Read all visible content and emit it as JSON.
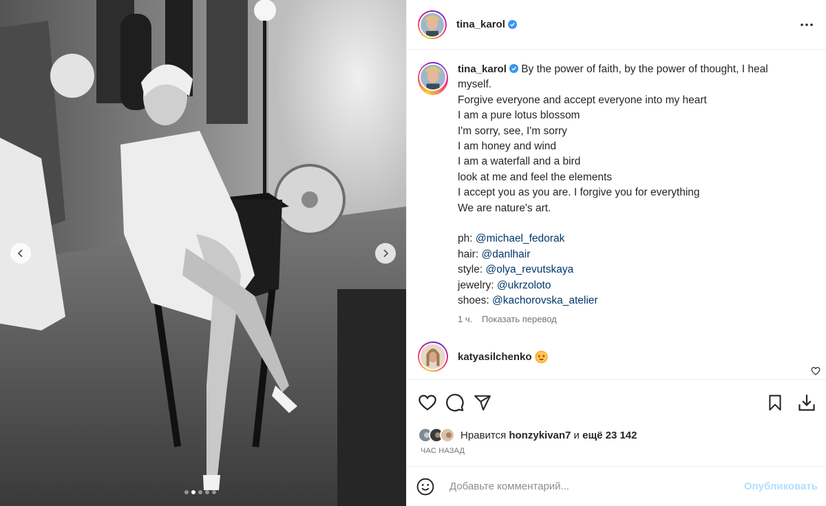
{
  "header": {
    "username": "tina_karol"
  },
  "caption": {
    "username": "tina_karol",
    "lines": [
      "By the power of faith, by the power of thought, I heal myself.",
      "Forgive everyone and accept everyone into my heart",
      "I am a pure lotus blossom",
      "I'm sorry, see, I'm sorry",
      "I am honey and wind",
      "I am a waterfall and a bird",
      "look at me and feel the elements",
      "I accept you as you are. I forgive you for everything",
      "We are nature's art."
    ],
    "credits": [
      {
        "label": "ph: ",
        "mention": "@michael_fedorak"
      },
      {
        "label": "hair: ",
        "mention": "@danlhair"
      },
      {
        "label": "style: ",
        "mention": "@olya_revutskaya"
      },
      {
        "label": "jewelry: ",
        "mention": "@ukrzoloto"
      },
      {
        "label": "shoes: ",
        "mention": "@kachorovska_atelier"
      }
    ],
    "time": "1 ч.",
    "translate": "Показать перевод"
  },
  "comment": {
    "username": "katyasilchenko"
  },
  "likes": {
    "prefix": "Нравится ",
    "user": "honzykivan7",
    "middle": " и ",
    "count": "ещё 23 142"
  },
  "time_label": "ЧАС НАЗАД",
  "comment_box": {
    "placeholder": "Добавьте комментарий...",
    "publish": "Опубликовать"
  },
  "carousel": {
    "total": 5,
    "active": 2
  },
  "colors": {
    "mention": "#00376b",
    "verified": "#3897f0",
    "publish_disabled": "#b2dffc"
  }
}
